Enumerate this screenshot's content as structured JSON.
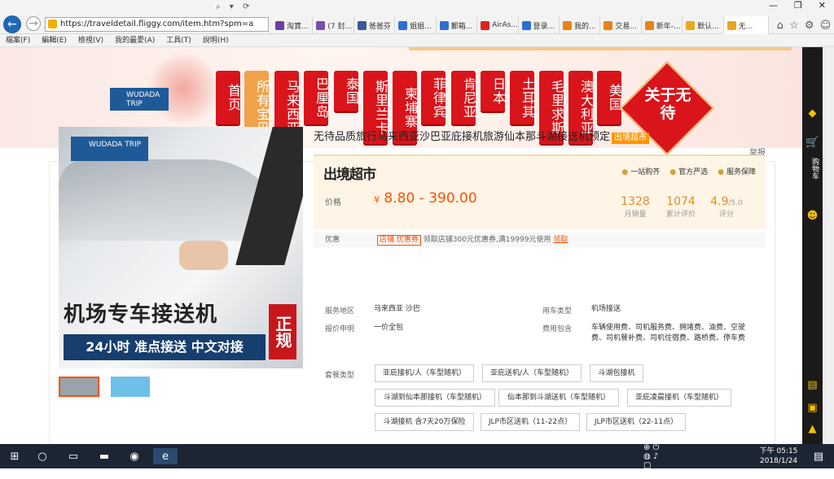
{
  "browser": {
    "url": "https://traveldetail.fliggy.com/item.htm?spm=a",
    "tabs": [
      "淘寶...",
      "(7 封...",
      "爸爸芬",
      "姐姐...",
      "郵箱...",
      "AirAs...",
      "登录...",
      "我的...",
      "交易...",
      "新年-...",
      "默认...",
      "无..."
    ],
    "window_controls": [
      "—",
      "❐",
      "✕"
    ]
  },
  "menu": [
    "檔案(F)",
    "編輯(E)",
    "檢視(V)",
    "我的最愛(A)",
    "工具(T)",
    "說明(H)"
  ],
  "banner": {
    "logo": "WUDADA TRIP",
    "categories": [
      "首页",
      "所有宝贝",
      "马来西亚",
      "巴厘岛",
      "泰国",
      "斯里兰卡",
      "柬埔寨",
      "菲律宾",
      "肯尼亚",
      "日本",
      "土耳其",
      "毛里求斯",
      "澳大利亚",
      "美国"
    ],
    "selected_index": 1,
    "about": "关于无待"
  },
  "product": {
    "image_logo": "WUDADA TRIP",
    "image_title": "机场专车接送机",
    "image_subtitle": "24小时 准点接送 中文对接",
    "image_tag": "正规",
    "title": "无待品质旅行马来西亚沙巴亚庇接机旅游仙本那斗湖接送机预定",
    "title_tag": "出境超市",
    "report": "举报",
    "brand": "出境超市",
    "badges": [
      "一站购齐",
      "官方严选",
      "服务保障"
    ],
    "price_label": "价格",
    "price_currency": "¥",
    "price": "8.80 - 390.00",
    "stats": [
      {
        "value": "1328",
        "label": "月销量"
      },
      {
        "value": "1074",
        "label": "累计评价"
      },
      {
        "value": "4.9",
        "suffix": "/5.0",
        "label": "评分"
      }
    ],
    "promo_label": "优惠",
    "promo_tag": "店铺 优惠券",
    "promo_text": "领取店铺300元优惠券,满19999元使用",
    "promo_link": "领取",
    "service_area_label": "服务地区",
    "service_area": "马来西亚   沙巴",
    "car_type_label": "用车类型",
    "car_type": "机场接送",
    "quote_label": "报价申明",
    "quote": "一价全包",
    "fee_label": "费用包含",
    "fee": "车辆使用费、司机服务费、拥堵费、油费、空驶费、司机餐补费、司机住宿费、路桥费、停车费",
    "package_label": "套餐类型",
    "packages": [
      "亚庇接机/人（车型随机）",
      "亚庇送机/人（车型随机）",
      "斗湖包接机",
      "斗湖到仙本那接机（车型随机）",
      "仙本那到斗湖送机（车型随机）",
      "亚庇凌晨接机（车型随机）",
      "斗湖接机 含7天20万保险",
      "JLP市区送机（11-22点）",
      "JLP市区送机（22-11点）"
    ]
  },
  "sidebar": {
    "cart": "购物车"
  },
  "taskbar": {
    "time": "下午 05:15",
    "date": "2018/1/24"
  }
}
